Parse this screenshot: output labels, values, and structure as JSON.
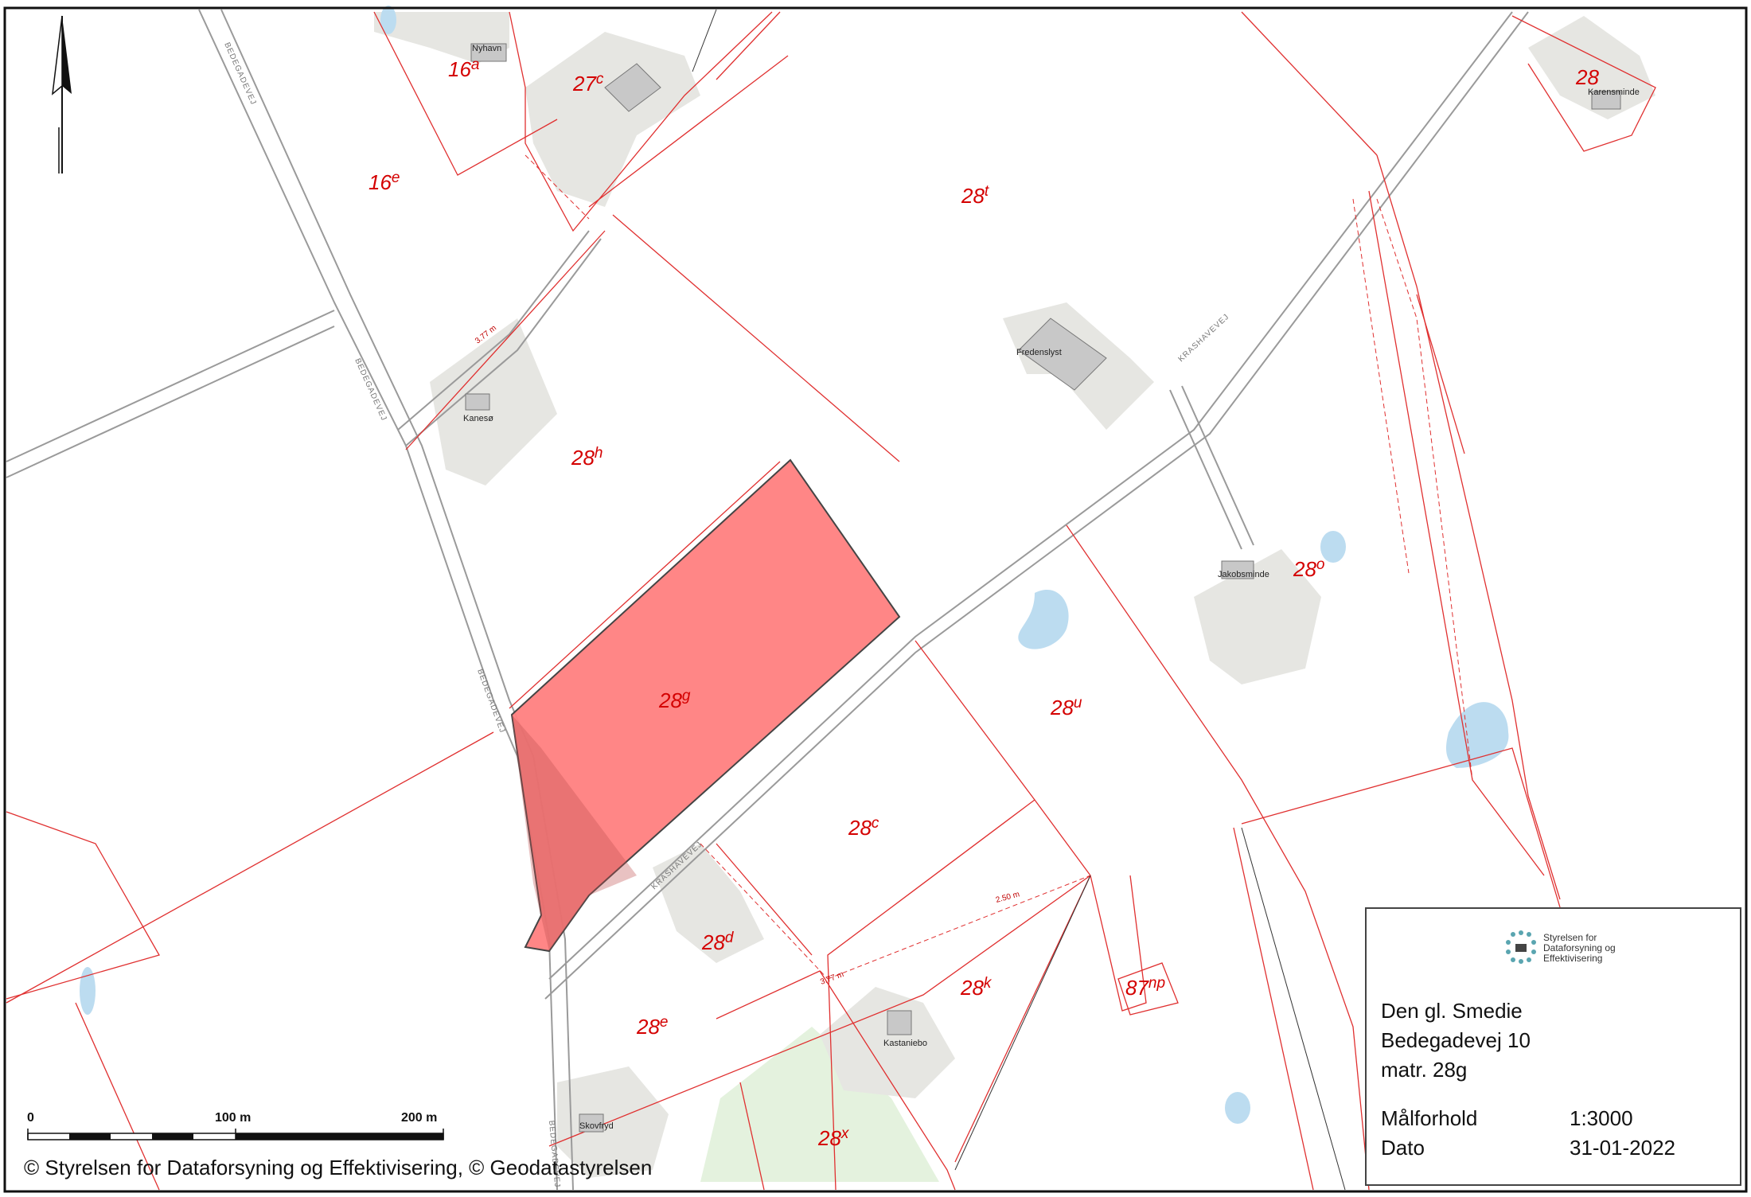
{
  "map": {
    "parcels": [
      {
        "base": "16",
        "sup": "a"
      },
      {
        "base": "16",
        "sup": "e"
      },
      {
        "base": "27",
        "sup": "c"
      },
      {
        "base": "28",
        "sup": "t"
      },
      {
        "base": "28",
        "sup": "h"
      },
      {
        "base": "28",
        "sup": "g"
      },
      {
        "base": "28",
        "sup": "o"
      },
      {
        "base": "28",
        "sup": "u"
      },
      {
        "base": "28",
        "sup": "c"
      },
      {
        "base": "28",
        "sup": "d"
      },
      {
        "base": "28",
        "sup": "k"
      },
      {
        "base": "28",
        "sup": "e"
      },
      {
        "base": "28",
        "sup": "x"
      },
      {
        "base": "87",
        "sup": "np"
      },
      {
        "base": "28",
        "sup": ""
      }
    ],
    "buildings": [
      "Nyhavn",
      "Kanesø",
      "Fredenslyst",
      "Karensminde",
      "Jakobsminde",
      "Kastaniebo",
      "Skovfryd"
    ],
    "roads": [
      "BEDEGADEVEJ",
      "BEDEGADEVEJ",
      "BEDEGADEVEJ",
      "BEDEGADEVEJ",
      "KRASHAVEVEJ",
      "KRASHAVEVEJ"
    ],
    "dimensions": [
      "3.77 m",
      "2.50 m",
      "3.77 m"
    ],
    "highlight_color": "#ff8080",
    "parcel_line_color": "#e03030"
  },
  "scale_bar": {
    "ticks": [
      "0",
      "100 m",
      "200 m"
    ]
  },
  "copyright": "© Styrelsen for Dataforsyning og Effektivisering, © Geodatastyrelsen",
  "legend": {
    "logo_text": "Styrelsen for Dataforsyning og Effektivisering",
    "title_line1": "Den gl. Smedie",
    "title_line2": "Bedegadevej 10",
    "title_line3": "matr. 28g",
    "scale_label": "Målforhold",
    "scale_value": "1:3000",
    "date_label": "Dato",
    "date_value": "31-01-2022"
  },
  "north_arrow": "north-arrow-icon"
}
